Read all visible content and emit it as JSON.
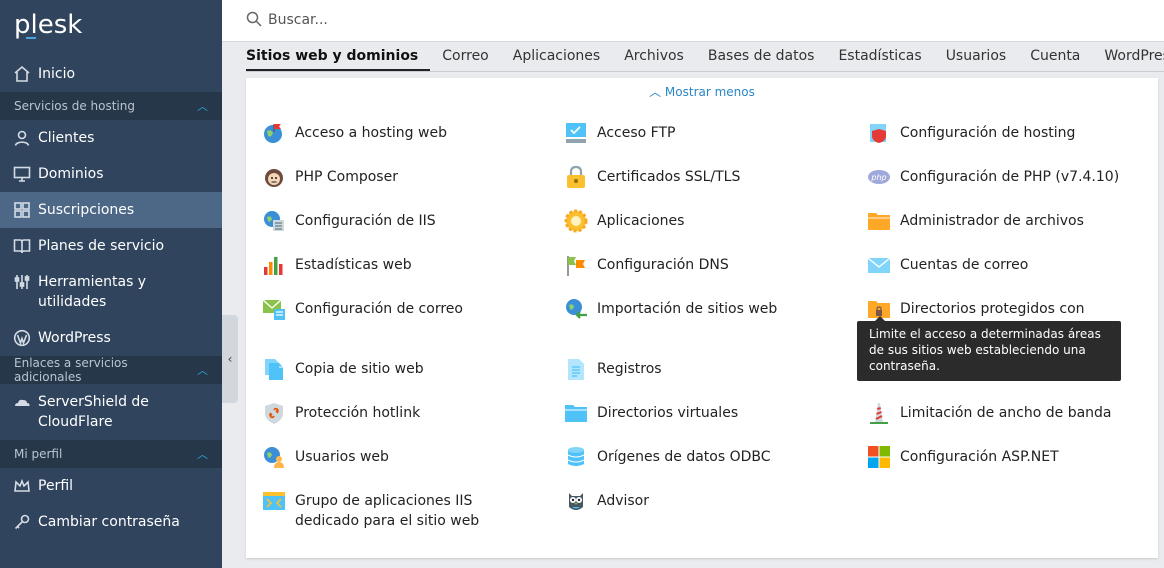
{
  "logo": "plesk",
  "search": {
    "placeholder": "Buscar..."
  },
  "sidebar": {
    "home": "Inicio",
    "section_hosting": "Servicios de hosting",
    "clients": "Clientes",
    "domains": "Dominios",
    "subscriptions": "Suscripciones",
    "plans": "Planes de servicio",
    "tools": "Herramientas y utilidades",
    "wordpress": "WordPress",
    "section_links": "Enlaces a servicios adicionales",
    "servershield": "ServerShield de CloudFlare",
    "section_profile": "Mi perfil",
    "profile": "Perfil",
    "change_password": "Cambiar contraseña",
    "collapse_symbol": "‹"
  },
  "tabs": [
    "Sitios web y dominios",
    "Correo",
    "Aplicaciones",
    "Archivos",
    "Bases de datos",
    "Estadísticas",
    "Usuarios",
    "Cuenta",
    "WordPress"
  ],
  "panel": {
    "show_less": "Mostrar menos",
    "items": [
      "Acceso a hosting web",
      "Acceso FTP",
      "Configuración de hosting",
      "PHP Composer",
      "Certificados SSL/TLS",
      "Configuración de PHP (v7.4.10)",
      "Configuración de IIS",
      "Aplicaciones",
      "Administrador de archivos",
      "Estadísticas web",
      "Configuración DNS",
      "Cuentas de correo",
      "Configuración de correo",
      "Importación de sitios web",
      "Directorios protegidos con",
      "Copia de sitio web",
      "Registros",
      "Protección hotlink",
      "Directorios virtuales",
      "Limitación de ancho de banda",
      "Usuarios web",
      "Orígenes de datos ODBC",
      "Configuración ASP.NET",
      "Grupo de aplicaciones IIS dedicado para el sitio web",
      "Advisor"
    ],
    "tooltip": "Limite el acceso a determinadas áreas de sus sitios web estableciendo una contraseña."
  }
}
